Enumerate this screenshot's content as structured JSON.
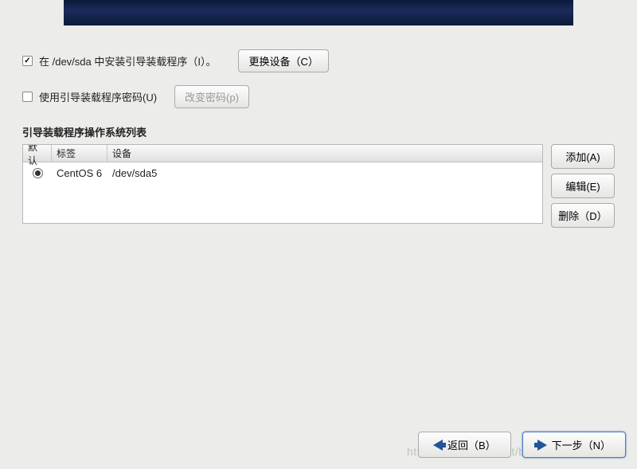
{
  "installBootloader": {
    "checked": true,
    "label": "在 /dev/sda 中安装引导装载程序（I）。",
    "changeDeviceBtn": "更换设备（C）"
  },
  "usePassword": {
    "checked": false,
    "label": "使用引导装载程序密码(U)",
    "changePasswordBtn": "改变密码(p)"
  },
  "osListSection": {
    "title": "引导装载程序操作系统列表",
    "headers": {
      "default": "默认",
      "label": "标签",
      "device": "设备"
    },
    "rows": [
      {
        "selected": true,
        "label": "CentOS 6",
        "device": "/dev/sda5"
      }
    ]
  },
  "sideButtons": {
    "add": "添加(A)",
    "edit": "编辑(E)",
    "delete": "删除（D）"
  },
  "footer": {
    "back": "返回（B）",
    "next": "下一步（N）"
  },
  "watermark": "https://blog.csdn.net/blue_CG"
}
